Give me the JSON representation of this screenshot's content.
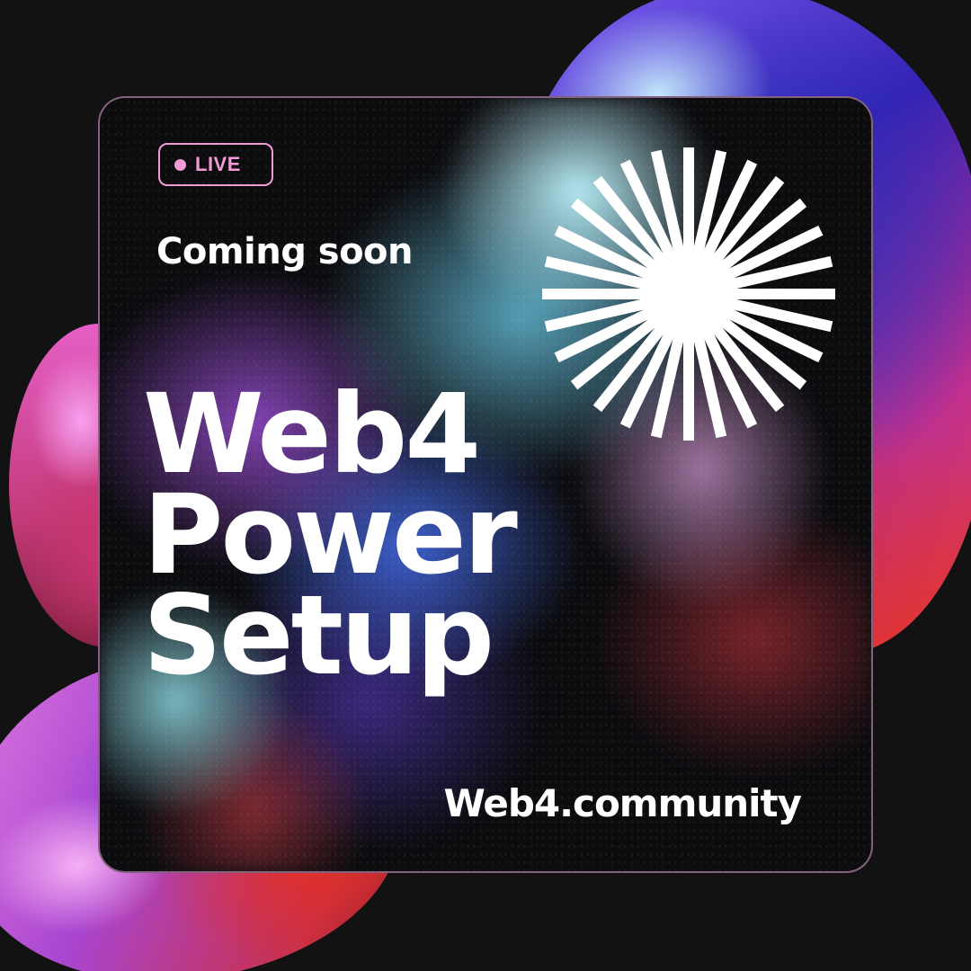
{
  "badge": {
    "label": "LIVE",
    "color": "#f29bd6"
  },
  "subtitle": "Coming soon",
  "headline": {
    "line1": "Web4",
    "line2": "Power",
    "line3": "Setup"
  },
  "url": "Web4.community",
  "colors": {
    "background": "#121212",
    "text": "#ffffff",
    "card_border": "#e6aadc"
  },
  "icons": {
    "logo": "starburst-icon"
  }
}
